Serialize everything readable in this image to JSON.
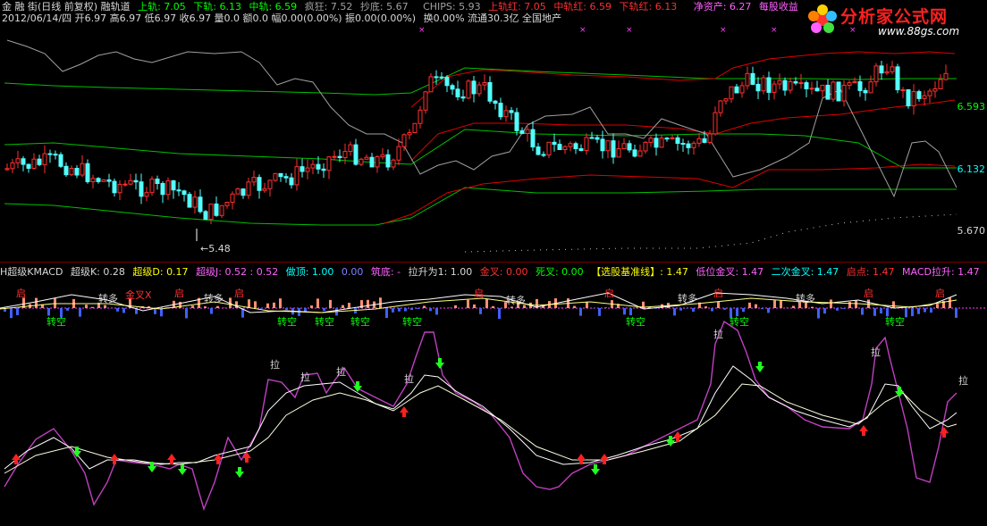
{
  "header1": {
    "title": "金 融 街(日线 前复权) 融轨道",
    "upper_label": "上轨: 7.05",
    "lower_label": "下轨: 6.13",
    "mid_label": "中轨: 6.59",
    "fengkuang": "疯狂: 7.52",
    "chaodi": "抄底: 5.67",
    "chips": "CHIPS: 5.93",
    "upper_red": "上轨红: 7.05",
    "mid_red": "中轨红: 6.59",
    "lower_red": "下轨红: 6.13",
    "net_assets": "净资产: 6.27",
    "per_share": "每股收益"
  },
  "header2": {
    "quote": "2012/06/14/四 开6.97 高6.97 低6.97 收6.97 量0.0 额0.0 幅0.00(0.00%) 振0.00(0.00%)",
    "turnover": "换0.00% 流通30.3亿 全国地产"
  },
  "logo": {
    "brand": "分析家公式网",
    "url": "www.88gs.com"
  },
  "axis": {
    "p1": "6.593",
    "p2": "6.132",
    "p3": "5.670",
    "low_mark": "←5.48"
  },
  "indicator_header": {
    "name": "H超级KMACD",
    "k": "超级K: 0.28",
    "d": "超级D: 0.17",
    "j": "超级J: 0.52 : 0.52",
    "top": "做顶: 1.00",
    "zero": "0.00",
    "bottom": "筑底: -",
    "pull": "拉升为1: 1.00",
    "golden": "金叉: 0.00",
    "dead": "死叉: 0.00",
    "select": "【选股基准线】: 1.47",
    "low_golden": "低位金叉: 1.47",
    "second_golden": "二次金叉: 1.47",
    "start": "启点: 1.47",
    "macd_pull": "MACD拉升: 1.47"
  },
  "signals": {
    "qi": "启",
    "zhuanduo": "转多",
    "zhuankong": "转空",
    "la": "拉",
    "jinchax": "金叉X"
  },
  "colors": {
    "bg": "#000000",
    "up": "#ff3030",
    "down": "#54ffff",
    "divider": "#7a0000"
  }
}
